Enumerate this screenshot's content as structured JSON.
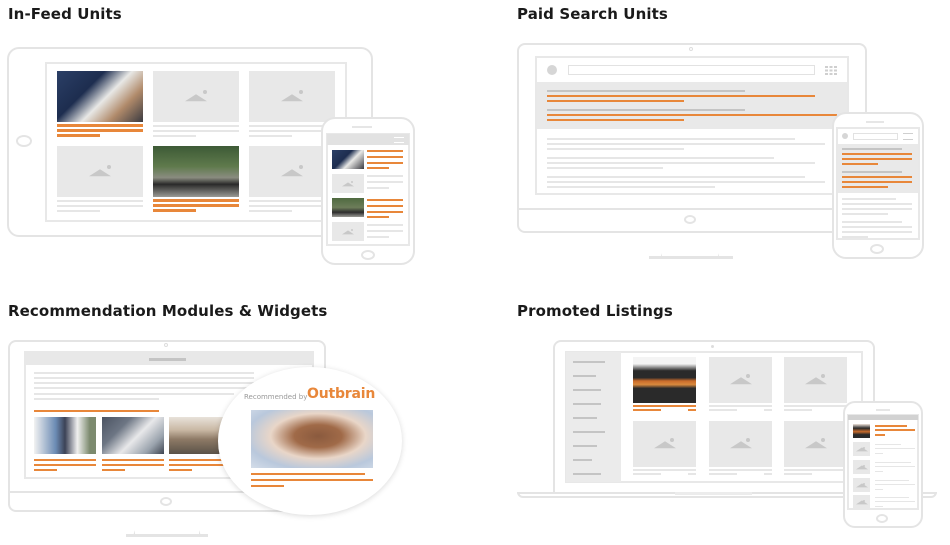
{
  "sections": {
    "in_feed": {
      "title": "In-Feed Units"
    },
    "paid_search": {
      "title": "Paid Search Units"
    },
    "recommendation": {
      "title": "Recommendation Modules & Widgets",
      "widget_label": "Recommended by",
      "brand": "Outbrain"
    },
    "promoted": {
      "title": "Promoted Listings"
    }
  },
  "colors": {
    "accent": "#e8873a",
    "placeholder": "#e8e8e8",
    "frame": "#e4e4e4"
  }
}
